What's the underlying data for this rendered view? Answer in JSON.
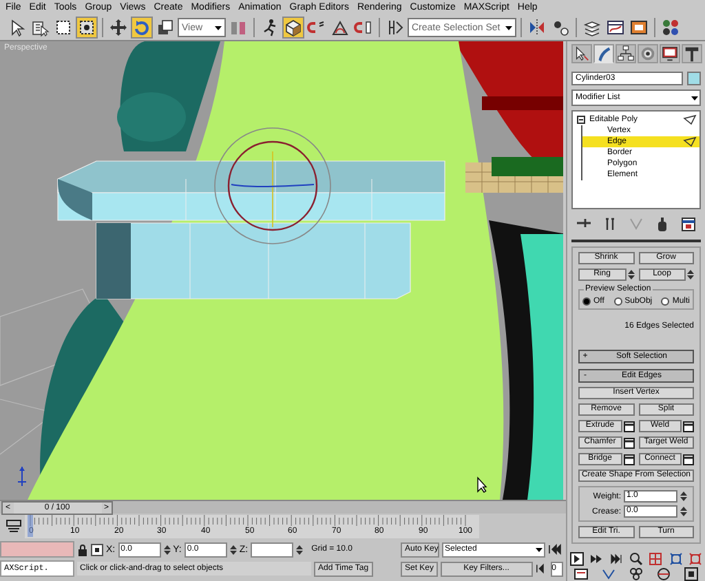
{
  "menu_bar": [
    "File",
    "Edit",
    "Tools",
    "Group",
    "Views",
    "Create",
    "Modifiers",
    "Animation",
    "Graph Editors",
    "Rendering",
    "Customize",
    "MAXScript",
    "Help"
  ],
  "toolbar": [
    {
      "kind": "button",
      "active": false
    },
    {
      "kind": "button",
      "active": false
    },
    {
      "kind": "button",
      "active": false
    },
    {
      "kind": "button",
      "active": true
    },
    {
      "kind": "separator"
    },
    {
      "kind": "button",
      "active": false
    },
    {
      "kind": "button",
      "active": true
    },
    {
      "kind": "button",
      "active": false
    },
    {
      "kind": "dropdown",
      "value": "View"
    },
    {
      "kind": "button",
      "active": false
    },
    {
      "kind": "separator"
    },
    {
      "kind": "button",
      "active": false
    },
    {
      "kind": "button",
      "active": true
    },
    {
      "kind": "button",
      "active": false
    },
    {
      "kind": "button",
      "active": false
    },
    {
      "kind": "button",
      "active": false
    },
    {
      "kind": "separator"
    },
    {
      "kind": "button",
      "active": false
    },
    {
      "kind": "dropdown",
      "value": "Create Selection Set"
    },
    {
      "kind": "separator"
    },
    {
      "kind": "button",
      "active": false
    },
    {
      "kind": "button",
      "active": false
    },
    {
      "kind": "separator"
    },
    {
      "kind": "button",
      "active": false
    },
    {
      "kind": "button",
      "active": false
    },
    {
      "kind": "button",
      "active": false
    },
    {
      "kind": "separator"
    },
    {
      "kind": "button",
      "active": false
    }
  ],
  "viewport": {
    "label": "Perspective"
  },
  "time_slider": {
    "prev": "<",
    "value": "0 / 100",
    "next": ">"
  },
  "ruler": {
    "ticks": [
      "0",
      "10",
      "20",
      "30",
      "40",
      "50",
      "60",
      "70",
      "80",
      "90",
      "100"
    ]
  },
  "status_bar": {
    "listener": "AXScript.",
    "prompt": "Click or click-and-drag to select objects",
    "coords": [
      {
        "label": "X:",
        "value": "0.0"
      },
      {
        "label": "Y:",
        "value": "0.0"
      },
      {
        "label": "Z:"
      }
    ],
    "grid": "Grid = 10.0",
    "time_tag": "Add Time Tag",
    "auto_key": "Auto Key",
    "key_mode": "Selected",
    "set_key": "Set Key",
    "key_filters": "Key Filters...",
    "frame": "0"
  },
  "command_panel": {
    "tabs": [
      {
        "selected": false
      },
      {
        "selected": true
      },
      {
        "selected": false
      },
      {
        "selected": false
      },
      {
        "selected": false
      },
      {
        "selected": false
      }
    ],
    "object_name": "Cylinder03",
    "modifier_list": "Modifier List",
    "stack": [
      {
        "label": "Editable Poly",
        "selected": false,
        "expanded": true,
        "children": [
          {
            "label": "Vertex",
            "selected": false
          },
          {
            "label": "Edge",
            "selected": true
          },
          {
            "label": "Border",
            "selected": false
          },
          {
            "label": "Polygon",
            "selected": false
          },
          {
            "label": "Element",
            "selected": false
          }
        ]
      }
    ],
    "selection": {
      "grow_buttons": [
        "Shrink",
        "Grow"
      ],
      "spinner_buttons": [
        "Ring",
        "Loop"
      ],
      "preview_title": "Preview Selection",
      "preview_options": [
        {
          "label": "Off",
          "selected": true
        },
        {
          "label": "SubObj",
          "selected": false
        },
        {
          "label": "Multi",
          "selected": false
        }
      ],
      "status": "16 Edges Selected"
    },
    "rollouts": [
      {
        "toggle": "+",
        "title": "Soft Selection"
      },
      {
        "toggle": "-",
        "title": "Edit Edges"
      }
    ],
    "edit_edges": {
      "rows": [
        [
          {
            "label": "Insert Vertex",
            "settings": false
          }
        ],
        [
          {
            "label": "Remove",
            "settings": false
          },
          {
            "label": "Split",
            "settings": false
          }
        ],
        [
          {
            "label": "Extrude",
            "settings": true
          },
          {
            "label": "Weld",
            "settings": true
          }
        ],
        [
          {
            "label": "Chamfer",
            "settings": true
          },
          {
            "label": "Target Weld",
            "settings": false
          }
        ],
        [
          {
            "label": "Bridge",
            "settings": true
          },
          {
            "label": "Connect",
            "settings": true
          }
        ],
        [
          {
            "label": "Create Shape From Selection",
            "settings": false
          }
        ]
      ],
      "spinners": [
        {
          "label": "Weight:",
          "value": "1.0"
        },
        {
          "label": "Crease:",
          "value": "0.0"
        }
      ],
      "bottom": [
        {
          "label": "Edit Tri.",
          "settings": false
        },
        {
          "label": "Turn",
          "settings": false
        }
      ]
    }
  }
}
